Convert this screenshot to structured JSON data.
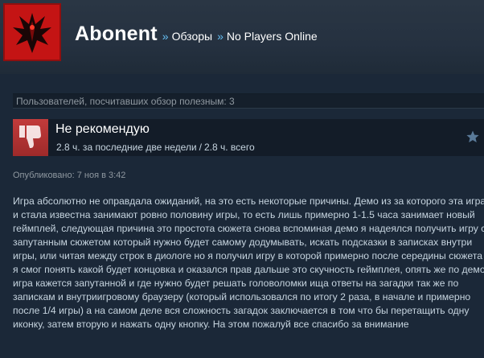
{
  "header": {
    "username": "Abonent",
    "separator": "»",
    "breadcrumb": [
      "Обзоры",
      "No Players Online"
    ]
  },
  "helpful": {
    "text": "Пользователей, посчитавших обзор полезным: 3"
  },
  "recommendation": {
    "title": "Не рекомендую",
    "hours_recent": "2.8 ч. за последние две недели",
    "hours_sep": "/",
    "hours_total": "2.8 ч. всего",
    "thumb_icon": "thumbs-down-icon",
    "star_icon": "star-icon"
  },
  "posted": "Опубликовано: 7 ноя в 3:42",
  "review": {
    "text": "Игра абсолютно не оправдала ожиданий, на это есть некоторые причины. Демо из за которого эта игра и стала известна занимают ровно половину игры, то есть лишь примерно 1-1.5 часа занимает новый геймплей, следующая причина это простота сюжета снова вспоминая демо я надеялся получить игру с запутанным сюжетом который нужно будет самому додумывать, искать подсказки в записках внутри игры, или читая между строк в диологе но я получил игру в которой примерно после середины сюжета я смог понять какой будет концовка и оказался прав дальше это скучность геймплея, опять же по демо игра кажется запутанной и где нужно будет решать головоломки ища ответы на загадки так же по запискам и внутриигровому браузеру (который использовался по итогу 2 раза, в начале и примерно после 1/4 игры) а на самом деле вся сложность загадок заключается в том что бы перетащить одну иконку, затем вторую и нажать одну кнопку. На этом пожалуй все спасибо за внимание"
  },
  "colors": {
    "background": "#1b2838",
    "avatar_red": "#c01212",
    "thumb_red": "#b33333",
    "link_blue": "#66c0f4"
  }
}
